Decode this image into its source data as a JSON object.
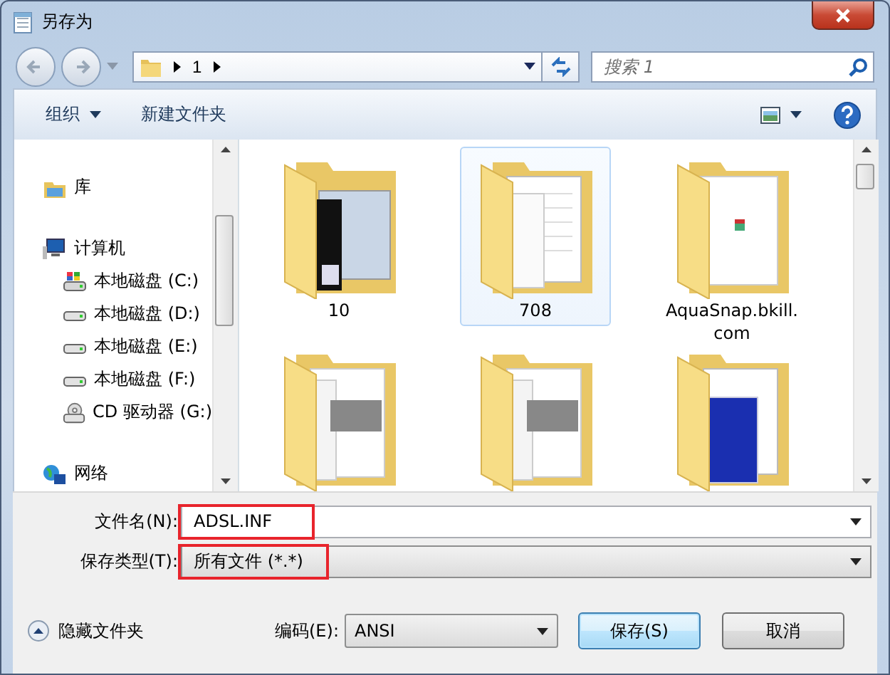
{
  "window": {
    "title": "另存为"
  },
  "address_bar": {
    "path": [
      {
        "label": "1"
      }
    ]
  },
  "search": {
    "placeholder": "搜索 1"
  },
  "toolbar": {
    "organize": "组织",
    "new_folder": "新建文件夹"
  },
  "sidebar": {
    "items": [
      {
        "label": "库",
        "kind": "library"
      },
      {
        "label": "计算机",
        "kind": "computer",
        "children": [
          {
            "label": "本地磁盘 (C:)",
            "kind": "system-drive"
          },
          {
            "label": "本地磁盘 (D:)",
            "kind": "drive"
          },
          {
            "label": "本地磁盘 (E:)",
            "kind": "drive"
          },
          {
            "label": "本地磁盘 (F:)",
            "kind": "drive"
          },
          {
            "label": "CD 驱动器 (G:)",
            "kind": "cd-drive"
          }
        ]
      },
      {
        "label": "网络",
        "kind": "network"
      }
    ]
  },
  "files": [
    {
      "name": "10",
      "selected": false,
      "kind": "card"
    },
    {
      "name": "708",
      "selected": true,
      "kind": "documents"
    },
    {
      "name": "AquaSnap.bkill.com",
      "selected": false,
      "kind": "thumbnail"
    },
    {
      "selected": false,
      "kind": "drive"
    },
    {
      "selected": false,
      "kind": "drive"
    },
    {
      "selected": false,
      "kind": "window"
    }
  ],
  "footer": {
    "file_name": {
      "label": "文件名(N):",
      "value": "ADSL.INF",
      "highlighted": true
    },
    "file_type": {
      "label": "保存类型(T):",
      "value": "所有文件  (*.*)",
      "highlighted": true
    },
    "hide_folders": "隐藏文件夹",
    "encoding": {
      "label": "编码(E):",
      "value": "ANSI"
    },
    "buttons": [
      {
        "label": "保存(S)",
        "default": true
      },
      {
        "label": "取消",
        "default": false
      }
    ]
  }
}
